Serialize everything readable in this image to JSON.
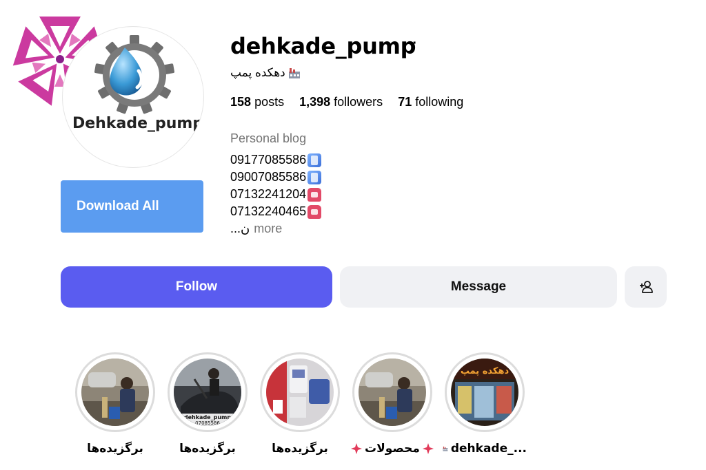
{
  "profile": {
    "username": "dehkade_pump",
    "full_name": "دهکده پمپ",
    "avatar_logo_text": "Dehkade_pump",
    "stats": {
      "posts_count": "158",
      "posts_label": "posts",
      "followers_count": "1,398",
      "followers_label": "followers",
      "following_count": "71",
      "following_label": "following"
    },
    "category": "Personal blog",
    "bio_lines": [
      "09177085586",
      "09007085586",
      "07132241204",
      "07132240465"
    ],
    "bio_truncated": "...ن",
    "more_label": "more"
  },
  "actions": {
    "download_all_label": "Download All",
    "follow_label": "Follow",
    "message_label": "Message"
  },
  "highlights": [
    {
      "label": "برگزیده‌ها"
    },
    {
      "label": "برگزیده‌ها",
      "overlay_text_1": "dehkade_pump",
      "overlay_text_2": "07085586"
    },
    {
      "label": "برگزیده‌ها"
    },
    {
      "label": "محصولات"
    },
    {
      "label": "dehkade_...",
      "overlay_text": "دهکده پمپ"
    }
  ],
  "colors": {
    "follow": "#5a5cf0",
    "download": "#5b9cf0",
    "secondary_button": "#f0f1f4",
    "muted_text": "#737373"
  }
}
